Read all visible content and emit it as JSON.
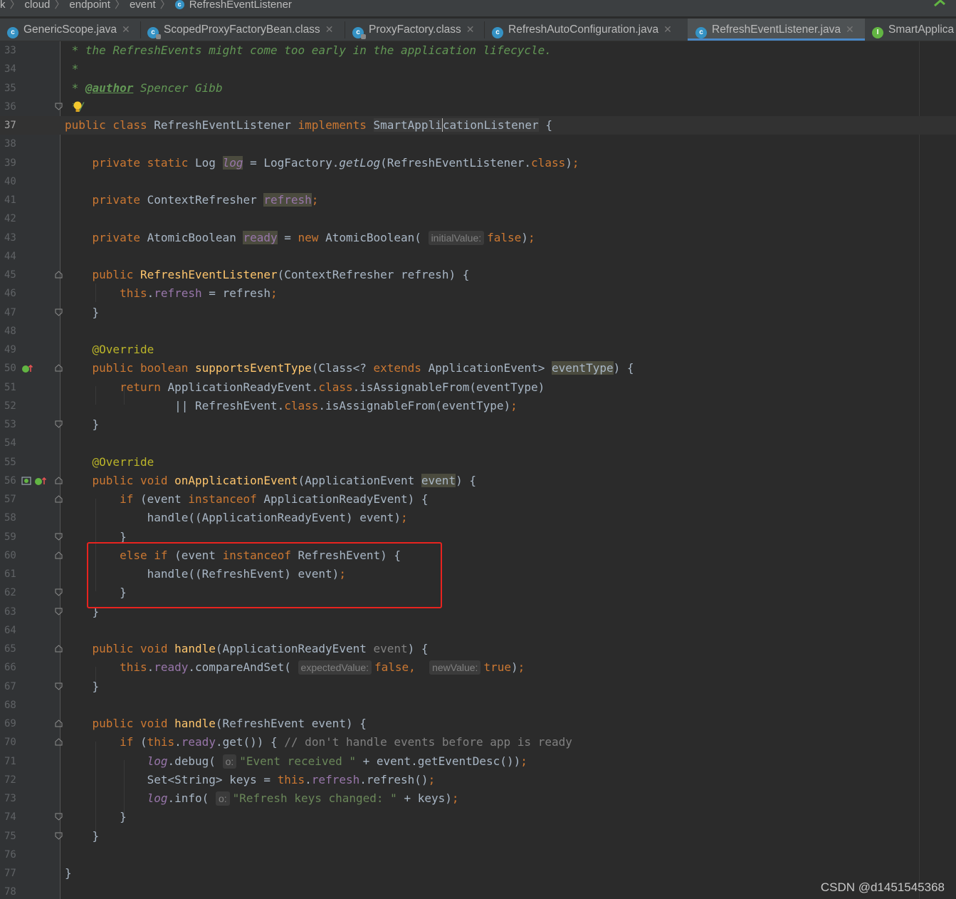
{
  "breadcrumb": [
    "k",
    "cloud",
    "endpoint",
    "event",
    "RefreshEventListener"
  ],
  "tabs": [
    {
      "label": "GenericScope.java",
      "icon": "class-icon"
    },
    {
      "label": "ScopedProxyFactoryBean.class",
      "icon": "class-locked-icon"
    },
    {
      "label": "ProxyFactory.class",
      "icon": "class-locked-icon"
    },
    {
      "label": "RefreshAutoConfiguration.java",
      "icon": "class-icon"
    },
    {
      "label": "RefreshEventListener.java",
      "icon": "class-icon",
      "active": true
    },
    {
      "label": "SmartApplica",
      "icon": "interface-icon"
    }
  ],
  "editor": {
    "line_numbers": [
      "33",
      "34",
      "35",
      "36",
      "37",
      "38",
      "39",
      "40",
      "41",
      "42",
      "43",
      "44",
      "45",
      "46",
      "47",
      "48",
      "49",
      "50",
      "51",
      "52",
      "53",
      "54",
      "55",
      "56",
      "57",
      "58",
      "59",
      "60",
      "61",
      "62",
      "63",
      "64",
      "65",
      "66",
      "67",
      "68",
      "69",
      "70",
      "71",
      "72",
      "73",
      "74",
      "75",
      "76",
      "77",
      "78"
    ],
    "current_line": "37",
    "param_hints": {
      "initial_value": "initialValue:",
      "expected_value": "expectedValue:",
      "new_value": "newValue:",
      "o1": "o:",
      "o2": "o:"
    }
  },
  "colors": {
    "keyword": "#cc7832",
    "comment": "#629755",
    "method": "#ffc66d",
    "field": "#9876aa",
    "string": "#6a8759",
    "annotation": "#bbb529",
    "highlight_box": "#e8231f"
  },
  "watermark": "CSDN @d1451545368"
}
